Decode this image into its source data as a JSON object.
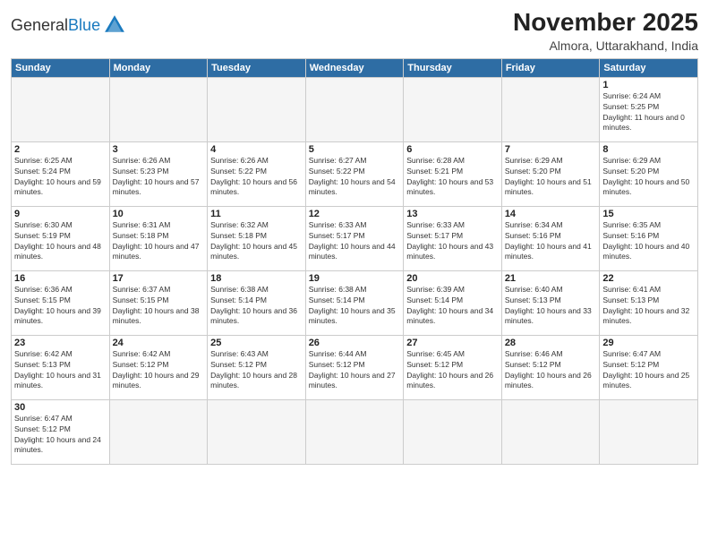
{
  "header": {
    "logo_general": "General",
    "logo_blue": "Blue",
    "title": "November 2025",
    "subtitle": "Almora, Uttarakhand, India"
  },
  "weekdays": [
    "Sunday",
    "Monday",
    "Tuesday",
    "Wednesday",
    "Thursday",
    "Friday",
    "Saturday"
  ],
  "weeks": [
    [
      {
        "day": "",
        "empty": true
      },
      {
        "day": "",
        "empty": true
      },
      {
        "day": "",
        "empty": true
      },
      {
        "day": "",
        "empty": true
      },
      {
        "day": "",
        "empty": true
      },
      {
        "day": "",
        "empty": true
      },
      {
        "day": "1",
        "sunrise": "6:24 AM",
        "sunset": "5:25 PM",
        "daylight": "11 hours and 0 minutes."
      }
    ],
    [
      {
        "day": "2",
        "sunrise": "6:25 AM",
        "sunset": "5:24 PM",
        "daylight": "10 hours and 59 minutes."
      },
      {
        "day": "3",
        "sunrise": "6:26 AM",
        "sunset": "5:23 PM",
        "daylight": "10 hours and 57 minutes."
      },
      {
        "day": "4",
        "sunrise": "6:26 AM",
        "sunset": "5:22 PM",
        "daylight": "10 hours and 56 minutes."
      },
      {
        "day": "5",
        "sunrise": "6:27 AM",
        "sunset": "5:22 PM",
        "daylight": "10 hours and 54 minutes."
      },
      {
        "day": "6",
        "sunrise": "6:28 AM",
        "sunset": "5:21 PM",
        "daylight": "10 hours and 53 minutes."
      },
      {
        "day": "7",
        "sunrise": "6:29 AM",
        "sunset": "5:20 PM",
        "daylight": "10 hours and 51 minutes."
      },
      {
        "day": "8",
        "sunrise": "6:29 AM",
        "sunset": "5:20 PM",
        "daylight": "10 hours and 50 minutes."
      }
    ],
    [
      {
        "day": "9",
        "sunrise": "6:30 AM",
        "sunset": "5:19 PM",
        "daylight": "10 hours and 48 minutes."
      },
      {
        "day": "10",
        "sunrise": "6:31 AM",
        "sunset": "5:18 PM",
        "daylight": "10 hours and 47 minutes."
      },
      {
        "day": "11",
        "sunrise": "6:32 AM",
        "sunset": "5:18 PM",
        "daylight": "10 hours and 45 minutes."
      },
      {
        "day": "12",
        "sunrise": "6:33 AM",
        "sunset": "5:17 PM",
        "daylight": "10 hours and 44 minutes."
      },
      {
        "day": "13",
        "sunrise": "6:33 AM",
        "sunset": "5:17 PM",
        "daylight": "10 hours and 43 minutes."
      },
      {
        "day": "14",
        "sunrise": "6:34 AM",
        "sunset": "5:16 PM",
        "daylight": "10 hours and 41 minutes."
      },
      {
        "day": "15",
        "sunrise": "6:35 AM",
        "sunset": "5:16 PM",
        "daylight": "10 hours and 40 minutes."
      }
    ],
    [
      {
        "day": "16",
        "sunrise": "6:36 AM",
        "sunset": "5:15 PM",
        "daylight": "10 hours and 39 minutes."
      },
      {
        "day": "17",
        "sunrise": "6:37 AM",
        "sunset": "5:15 PM",
        "daylight": "10 hours and 38 minutes."
      },
      {
        "day": "18",
        "sunrise": "6:38 AM",
        "sunset": "5:14 PM",
        "daylight": "10 hours and 36 minutes."
      },
      {
        "day": "19",
        "sunrise": "6:38 AM",
        "sunset": "5:14 PM",
        "daylight": "10 hours and 35 minutes."
      },
      {
        "day": "20",
        "sunrise": "6:39 AM",
        "sunset": "5:14 PM",
        "daylight": "10 hours and 34 minutes."
      },
      {
        "day": "21",
        "sunrise": "6:40 AM",
        "sunset": "5:13 PM",
        "daylight": "10 hours and 33 minutes."
      },
      {
        "day": "22",
        "sunrise": "6:41 AM",
        "sunset": "5:13 PM",
        "daylight": "10 hours and 32 minutes."
      }
    ],
    [
      {
        "day": "23",
        "sunrise": "6:42 AM",
        "sunset": "5:13 PM",
        "daylight": "10 hours and 31 minutes."
      },
      {
        "day": "24",
        "sunrise": "6:42 AM",
        "sunset": "5:12 PM",
        "daylight": "10 hours and 29 minutes."
      },
      {
        "day": "25",
        "sunrise": "6:43 AM",
        "sunset": "5:12 PM",
        "daylight": "10 hours and 28 minutes."
      },
      {
        "day": "26",
        "sunrise": "6:44 AM",
        "sunset": "5:12 PM",
        "daylight": "10 hours and 27 minutes."
      },
      {
        "day": "27",
        "sunrise": "6:45 AM",
        "sunset": "5:12 PM",
        "daylight": "10 hours and 26 minutes."
      },
      {
        "day": "28",
        "sunrise": "6:46 AM",
        "sunset": "5:12 PM",
        "daylight": "10 hours and 26 minutes."
      },
      {
        "day": "29",
        "sunrise": "6:47 AM",
        "sunset": "5:12 PM",
        "daylight": "10 hours and 25 minutes."
      }
    ],
    [
      {
        "day": "30",
        "sunrise": "6:47 AM",
        "sunset": "5:12 PM",
        "daylight": "10 hours and 24 minutes."
      },
      {
        "day": "",
        "empty": true
      },
      {
        "day": "",
        "empty": true
      },
      {
        "day": "",
        "empty": true
      },
      {
        "day": "",
        "empty": true
      },
      {
        "day": "",
        "empty": true
      },
      {
        "day": "",
        "empty": true
      }
    ]
  ]
}
